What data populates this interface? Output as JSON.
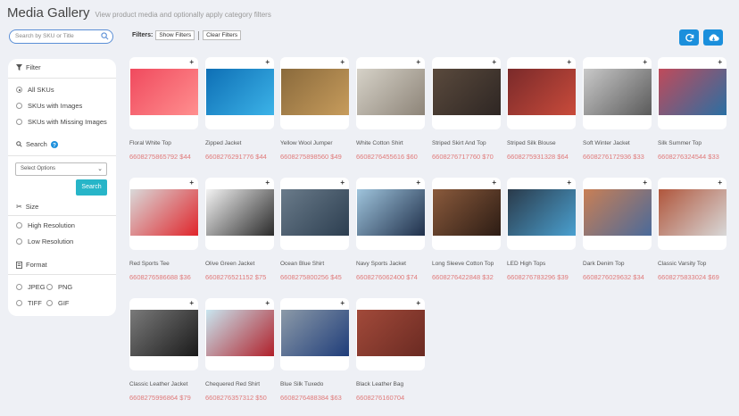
{
  "header": {
    "title": "Media Gallery",
    "subtitle": "View product media and optionally apply category filters"
  },
  "search": {
    "placeholder": "Search by SKU or Title"
  },
  "filters_bar": {
    "label": "Filters:",
    "show_label": "Show Filters",
    "clear_label": "Clear Filters"
  },
  "toolbar": {
    "refresh_icon": "refresh-icon",
    "download_icon": "cloud-download-icon",
    "accent": "#1b8fdc"
  },
  "sidebar": {
    "filter_heading": "Filter",
    "sku_options": [
      "All SKUs",
      "SKUs with Images",
      "SKUs with Missing Images"
    ],
    "search_heading": "Search",
    "select_placeholder": "Select Options",
    "search_button": "Search",
    "size_heading": "Size",
    "size_options": [
      "High Resolution",
      "Low Resolution"
    ],
    "format_heading": "Format",
    "format_options": [
      "JPEG",
      "PNG",
      "TIFF",
      "GIF"
    ]
  },
  "products": [
    {
      "title": "Floral White Top",
      "sku": "6608275865792",
      "price": "$44"
    },
    {
      "title": "Zipped Jacket",
      "sku": "6608276291776",
      "price": "$44"
    },
    {
      "title": "Yellow Wool Jumper",
      "sku": "6608275898560",
      "price": "$49"
    },
    {
      "title": "White Cotton Shirt",
      "sku": "6608276455616",
      "price": "$60"
    },
    {
      "title": "Striped Skirt And Top",
      "sku": "6608276717760",
      "price": "$70"
    },
    {
      "title": "Striped Silk Blouse",
      "sku": "6608275931328",
      "price": "$64"
    },
    {
      "title": "Soft Winter Jacket",
      "sku": "6608276172936",
      "price": "$33"
    },
    {
      "title": "Silk Summer Top",
      "sku": "6608276324544",
      "price": "$33"
    },
    {
      "title": "Red Sports Tee",
      "sku": "6608276586688",
      "price": "$36"
    },
    {
      "title": "Olive Green Jacket",
      "sku": "6608276521152",
      "price": "$75"
    },
    {
      "title": "Ocean Blue Shirt",
      "sku": "6608275800256",
      "price": "$45"
    },
    {
      "title": "Navy Sports Jacket",
      "sku": "6608276062400",
      "price": "$74"
    },
    {
      "title": "Long Sleeve Cotton Top",
      "sku": "6608276422848",
      "price": "$32"
    },
    {
      "title": "LED High Tops",
      "sku": "6608276783296",
      "price": "$39"
    },
    {
      "title": "Dark Denim Top",
      "sku": "6608276029632",
      "price": "$34"
    },
    {
      "title": "Classic Varsity Top",
      "sku": "6608275833024",
      "price": "$69"
    },
    {
      "title": "Classic Leather Jacket",
      "sku": "6608275996864",
      "price": "$79"
    },
    {
      "title": "Chequered Red Shirt",
      "sku": "6608276357312",
      "price": "$50"
    },
    {
      "title": "Blue Silk Tuxedo",
      "sku": "6608276488384",
      "price": "$63"
    },
    {
      "title": "Black Leather Bag",
      "sku": "6608276160704",
      "price": ""
    }
  ]
}
